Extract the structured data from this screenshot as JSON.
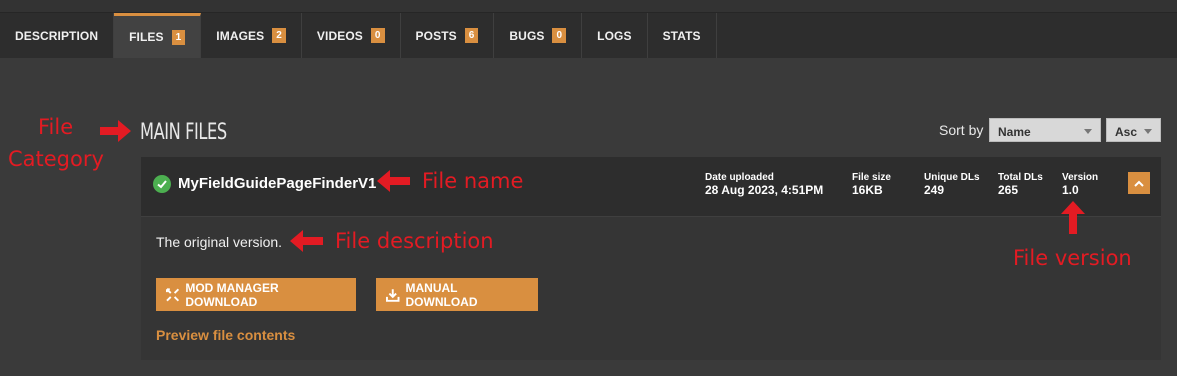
{
  "tabs": [
    {
      "label": "DESCRIPTION",
      "count": null,
      "active": false
    },
    {
      "label": "FILES",
      "count": "1",
      "active": true
    },
    {
      "label": "IMAGES",
      "count": "2",
      "active": false
    },
    {
      "label": "VIDEOS",
      "count": "0",
      "active": false
    },
    {
      "label": "POSTS",
      "count": "6",
      "active": false
    },
    {
      "label": "BUGS",
      "count": "0",
      "active": false
    },
    {
      "label": "LOGS",
      "count": null,
      "active": false
    },
    {
      "label": "STATS",
      "count": null,
      "active": false
    }
  ],
  "category": {
    "title": "MAIN FILES"
  },
  "sort": {
    "label": "Sort by",
    "field": "Name",
    "order": "Asc"
  },
  "file": {
    "name": "MyFieldGuidePageFinderV1",
    "date_label": "Date uploaded",
    "date_value": "28 Aug 2023, 4:51PM",
    "size_label": "File size",
    "size_value": "16KB",
    "unique_label": "Unique DLs",
    "unique_value": "249",
    "total_label": "Total DLs",
    "total_value": "265",
    "version_label": "Version",
    "version_value": "1.0",
    "description": "The original version.",
    "mod_manager_label": "MOD MANAGER DOWNLOAD",
    "manual_label": "MANUAL DOWNLOAD",
    "preview_label": "Preview file contents"
  },
  "annotations": {
    "category_line1": "File",
    "category_line2": "Category",
    "name": "File name",
    "description": "File description",
    "version": "File version"
  },
  "colors": {
    "accent": "#d98f40",
    "annotation": "#e31b23",
    "success": "#4caf50"
  }
}
